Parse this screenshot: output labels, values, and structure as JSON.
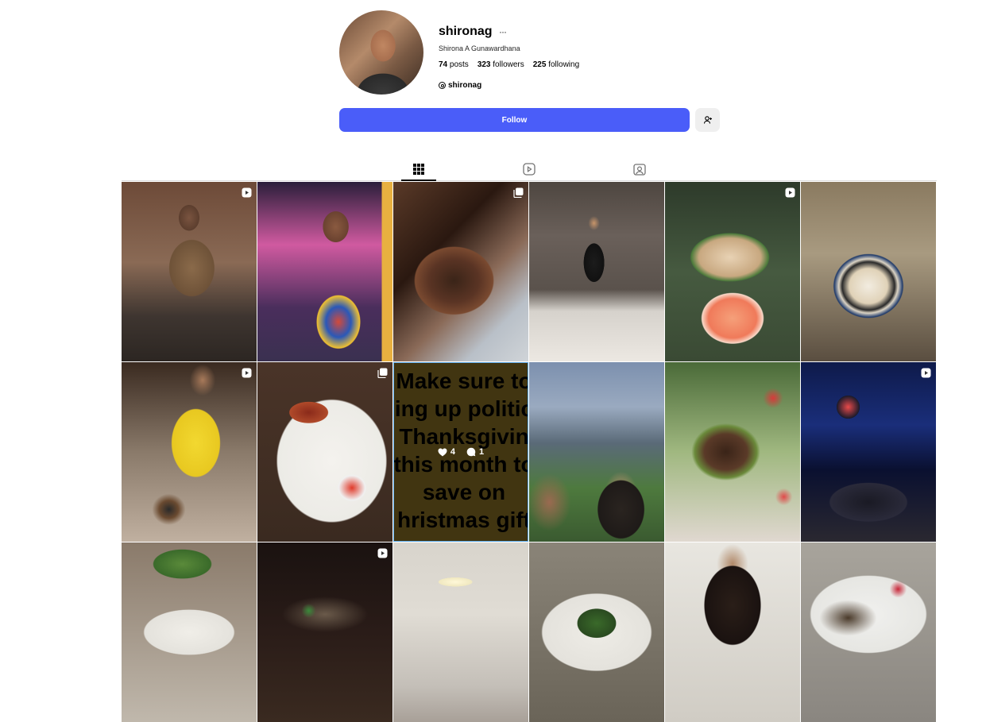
{
  "profile": {
    "username": "shironag",
    "more": "···",
    "full_name": "Shirona A Gunawardhana",
    "posts_count": "74",
    "posts_label": "posts",
    "followers_count": "323",
    "followers_label": "followers",
    "following_count": "225",
    "following_label": "following",
    "threads_handle": "shironag"
  },
  "actions": {
    "follow_label": "Follow",
    "suggest_icon": "add-person-icon"
  },
  "tabs": [
    {
      "name": "posts",
      "icon": "grid-icon",
      "active": true
    },
    {
      "name": "reels",
      "icon": "reels-icon",
      "active": false
    },
    {
      "name": "tagged",
      "icon": "tagged-icon",
      "active": false
    }
  ],
  "hover_post": {
    "likes": "4",
    "comments": "1",
    "text_lines": [
      "Make sure to",
      "ing up politic",
      "Thanksgivin",
      "this month to",
      "save on",
      "hristmas gift"
    ]
  },
  "colors": {
    "accent": "#4a5df9",
    "divider": "#dbdbdb"
  }
}
